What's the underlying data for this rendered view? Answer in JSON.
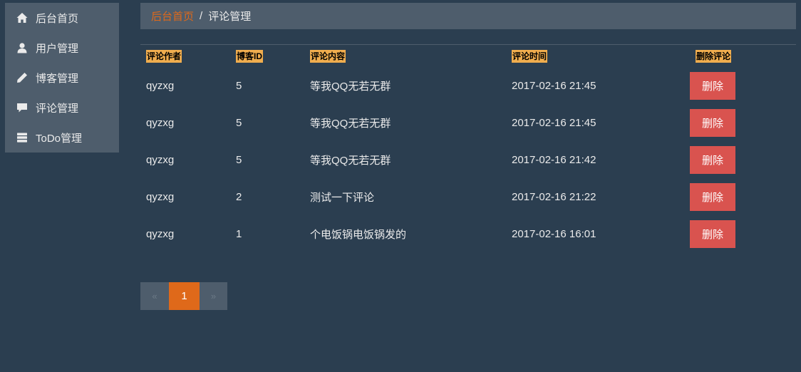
{
  "sidebar": {
    "items": [
      {
        "label": "后台首页",
        "icon": "home-icon"
      },
      {
        "label": "用户管理",
        "icon": "user-icon"
      },
      {
        "label": "博客管理",
        "icon": "pencil-icon"
      },
      {
        "label": "评论管理",
        "icon": "comment-icon"
      },
      {
        "label": "ToDo管理",
        "icon": "tasks-icon"
      }
    ]
  },
  "breadcrumb": {
    "home": "后台首页",
    "separator": "/",
    "current": "评论管理"
  },
  "table": {
    "headers": [
      "评论作者",
      "博客ID",
      "评论内容",
      "评论时间",
      "删除评论"
    ],
    "rows": [
      {
        "author": "qyzxg",
        "blog_id": "5",
        "content": "等我QQ无若无群",
        "time": "2017-02-16 21:45",
        "action": "删除"
      },
      {
        "author": "qyzxg",
        "blog_id": "5",
        "content": "等我QQ无若无群",
        "time": "2017-02-16 21:45",
        "action": "删除"
      },
      {
        "author": "qyzxg",
        "blog_id": "5",
        "content": "等我QQ无若无群",
        "time": "2017-02-16 21:42",
        "action": "删除"
      },
      {
        "author": "qyzxg",
        "blog_id": "2",
        "content": "测试一下评论",
        "time": "2017-02-16 21:22",
        "action": "删除"
      },
      {
        "author": "qyzxg",
        "blog_id": "1",
        "content": "个电饭锅电饭锅发的",
        "time": "2017-02-16 16:01",
        "action": "删除"
      }
    ]
  },
  "pagination": {
    "prev": "«",
    "current": "1",
    "next": "»"
  },
  "colors": {
    "background": "#2b3e50",
    "panel": "#4e5d6c",
    "accent": "#df691a",
    "header_label": "#f0ad4e",
    "danger": "#d9534f"
  }
}
